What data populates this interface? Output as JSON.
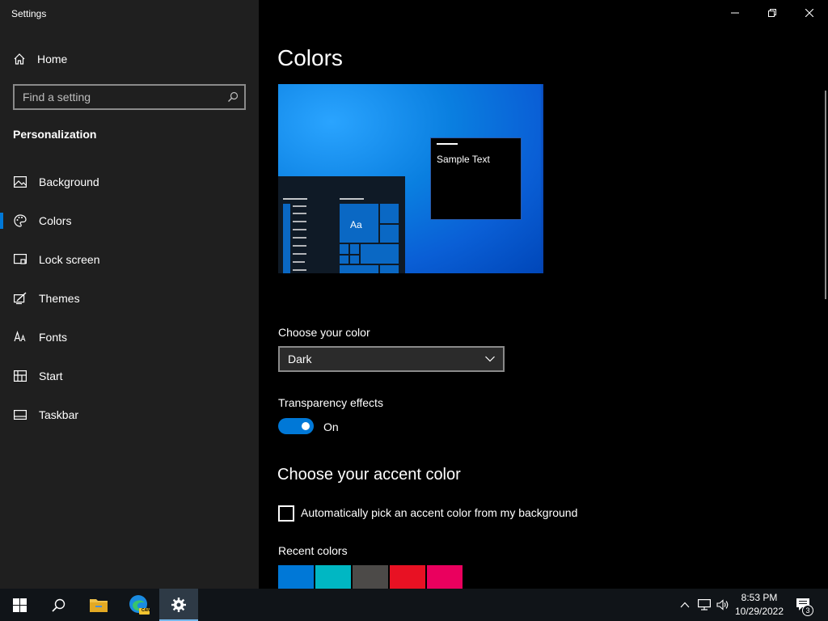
{
  "app_title": "Settings",
  "sidebar": {
    "home_label": "Home",
    "search_placeholder": "Find a setting",
    "section_title": "Personalization",
    "items": [
      {
        "label": "Background",
        "icon": "picture-icon"
      },
      {
        "label": "Colors",
        "icon": "palette-icon",
        "active": true
      },
      {
        "label": "Lock screen",
        "icon": "lock-screen-icon"
      },
      {
        "label": "Themes",
        "icon": "themes-icon"
      },
      {
        "label": "Fonts",
        "icon": "fonts-icon"
      },
      {
        "label": "Start",
        "icon": "start-icon"
      },
      {
        "label": "Taskbar",
        "icon": "taskbar-icon"
      }
    ]
  },
  "main": {
    "title": "Colors",
    "preview_sample_text": "Sample Text",
    "preview_tile_label": "Aa",
    "choose_color_label": "Choose your color",
    "choose_color_value": "Dark",
    "transparency_label": "Transparency effects",
    "transparency_state": "On",
    "accent_heading": "Choose your accent color",
    "auto_accent_label": "Automatically pick an accent color from my background",
    "recent_colors_label": "Recent colors",
    "recent_colors": [
      "#0078d7",
      "#00b7c3",
      "#4c4a48",
      "#e81123",
      "#ea005e"
    ]
  },
  "taskbar": {
    "time": "8:53 PM",
    "date": "10/29/2022",
    "notification_count": "3",
    "edge_badge": "CAN"
  },
  "colors": {
    "accent": "#0078d7",
    "sidebar_bg": "#1f1f1f",
    "main_bg": "#000000",
    "taskbar_bg": "#101418"
  }
}
